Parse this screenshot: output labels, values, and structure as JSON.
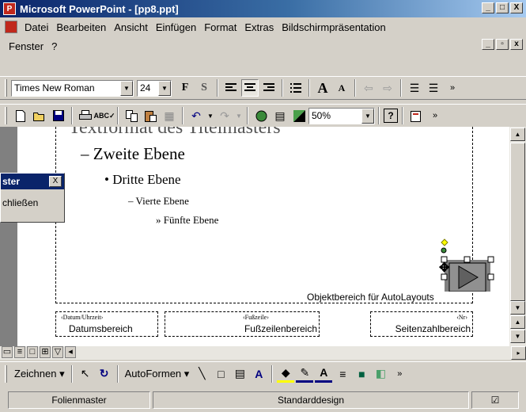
{
  "window": {
    "title": "Microsoft PowerPoint - [pp8.ppt]",
    "minimize": "_",
    "maximize": "□",
    "close": "X"
  },
  "menu": {
    "items": [
      "Datei",
      "Bearbeiten",
      "Ansicht",
      "Einfügen",
      "Format",
      "Extras",
      "Bildschirmpräsentation"
    ],
    "row2": [
      "Fenster",
      "?"
    ]
  },
  "format_toolbar": {
    "font": "Times New Roman",
    "size": "24",
    "bold": "F",
    "shadow": "S"
  },
  "standard_toolbar": {
    "zoom": "50%",
    "help": "?"
  },
  "slide": {
    "level2": "– Zweite Ebene",
    "level3": "• Dritte Ebene",
    "level4": "– Vierte Ebene",
    "level5": "» Fünfte Ebene",
    "autolayout_label": "Objektbereich für AutoLayouts",
    "date_tag": "‹Datum/Uhrzeit›",
    "date_label": "Datumsbereich",
    "footer_tag": "‹Fußzeile›",
    "footer_label": "Fußzeilenbereich",
    "number_tag": "‹Nr›",
    "number_label": "Seitenzahlbereich"
  },
  "palette": {
    "title": "ster",
    "close": "X",
    "button": "chließen"
  },
  "drawing_toolbar": {
    "draw": "Zeichnen",
    "autoshapes": "AutoFormen"
  },
  "status": {
    "left": "Folienmaster",
    "middle": "Standarddesign"
  },
  "colors": {
    "title_gradient_start": "#0a246a",
    "chrome": "#d4d0c8",
    "app_icon": "#c0281c",
    "workspace": "#808080"
  }
}
